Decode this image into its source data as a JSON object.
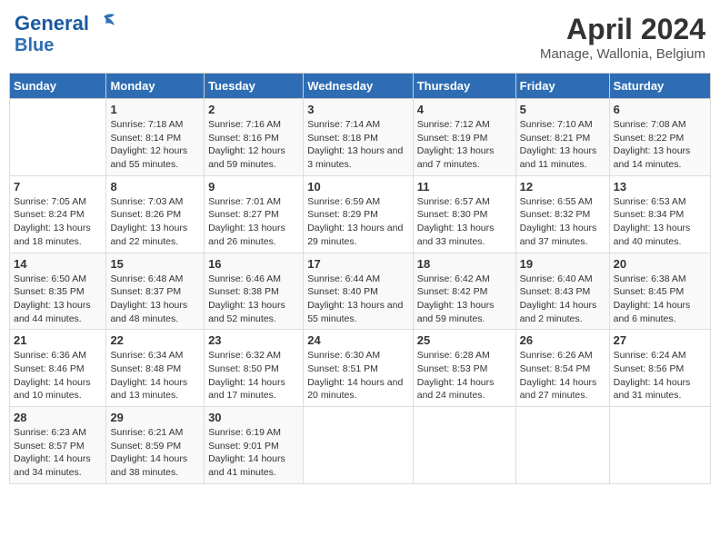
{
  "logo": {
    "line1": "General",
    "line2": "Blue"
  },
  "title": "April 2024",
  "subtitle": "Manage, Wallonia, Belgium",
  "days_of_week": [
    "Sunday",
    "Monday",
    "Tuesday",
    "Wednesday",
    "Thursday",
    "Friday",
    "Saturday"
  ],
  "weeks": [
    [
      {
        "num": "",
        "sunrise": "",
        "sunset": "",
        "daylight": ""
      },
      {
        "num": "1",
        "sunrise": "Sunrise: 7:18 AM",
        "sunset": "Sunset: 8:14 PM",
        "daylight": "Daylight: 12 hours and 55 minutes."
      },
      {
        "num": "2",
        "sunrise": "Sunrise: 7:16 AM",
        "sunset": "Sunset: 8:16 PM",
        "daylight": "Daylight: 12 hours and 59 minutes."
      },
      {
        "num": "3",
        "sunrise": "Sunrise: 7:14 AM",
        "sunset": "Sunset: 8:18 PM",
        "daylight": "Daylight: 13 hours and 3 minutes."
      },
      {
        "num": "4",
        "sunrise": "Sunrise: 7:12 AM",
        "sunset": "Sunset: 8:19 PM",
        "daylight": "Daylight: 13 hours and 7 minutes."
      },
      {
        "num": "5",
        "sunrise": "Sunrise: 7:10 AM",
        "sunset": "Sunset: 8:21 PM",
        "daylight": "Daylight: 13 hours and 11 minutes."
      },
      {
        "num": "6",
        "sunrise": "Sunrise: 7:08 AM",
        "sunset": "Sunset: 8:22 PM",
        "daylight": "Daylight: 13 hours and 14 minutes."
      }
    ],
    [
      {
        "num": "7",
        "sunrise": "Sunrise: 7:05 AM",
        "sunset": "Sunset: 8:24 PM",
        "daylight": "Daylight: 13 hours and 18 minutes."
      },
      {
        "num": "8",
        "sunrise": "Sunrise: 7:03 AM",
        "sunset": "Sunset: 8:26 PM",
        "daylight": "Daylight: 13 hours and 22 minutes."
      },
      {
        "num": "9",
        "sunrise": "Sunrise: 7:01 AM",
        "sunset": "Sunset: 8:27 PM",
        "daylight": "Daylight: 13 hours and 26 minutes."
      },
      {
        "num": "10",
        "sunrise": "Sunrise: 6:59 AM",
        "sunset": "Sunset: 8:29 PM",
        "daylight": "Daylight: 13 hours and 29 minutes."
      },
      {
        "num": "11",
        "sunrise": "Sunrise: 6:57 AM",
        "sunset": "Sunset: 8:30 PM",
        "daylight": "Daylight: 13 hours and 33 minutes."
      },
      {
        "num": "12",
        "sunrise": "Sunrise: 6:55 AM",
        "sunset": "Sunset: 8:32 PM",
        "daylight": "Daylight: 13 hours and 37 minutes."
      },
      {
        "num": "13",
        "sunrise": "Sunrise: 6:53 AM",
        "sunset": "Sunset: 8:34 PM",
        "daylight": "Daylight: 13 hours and 40 minutes."
      }
    ],
    [
      {
        "num": "14",
        "sunrise": "Sunrise: 6:50 AM",
        "sunset": "Sunset: 8:35 PM",
        "daylight": "Daylight: 13 hours and 44 minutes."
      },
      {
        "num": "15",
        "sunrise": "Sunrise: 6:48 AM",
        "sunset": "Sunset: 8:37 PM",
        "daylight": "Daylight: 13 hours and 48 minutes."
      },
      {
        "num": "16",
        "sunrise": "Sunrise: 6:46 AM",
        "sunset": "Sunset: 8:38 PM",
        "daylight": "Daylight: 13 hours and 52 minutes."
      },
      {
        "num": "17",
        "sunrise": "Sunrise: 6:44 AM",
        "sunset": "Sunset: 8:40 PM",
        "daylight": "Daylight: 13 hours and 55 minutes."
      },
      {
        "num": "18",
        "sunrise": "Sunrise: 6:42 AM",
        "sunset": "Sunset: 8:42 PM",
        "daylight": "Daylight: 13 hours and 59 minutes."
      },
      {
        "num": "19",
        "sunrise": "Sunrise: 6:40 AM",
        "sunset": "Sunset: 8:43 PM",
        "daylight": "Daylight: 14 hours and 2 minutes."
      },
      {
        "num": "20",
        "sunrise": "Sunrise: 6:38 AM",
        "sunset": "Sunset: 8:45 PM",
        "daylight": "Daylight: 14 hours and 6 minutes."
      }
    ],
    [
      {
        "num": "21",
        "sunrise": "Sunrise: 6:36 AM",
        "sunset": "Sunset: 8:46 PM",
        "daylight": "Daylight: 14 hours and 10 minutes."
      },
      {
        "num": "22",
        "sunrise": "Sunrise: 6:34 AM",
        "sunset": "Sunset: 8:48 PM",
        "daylight": "Daylight: 14 hours and 13 minutes."
      },
      {
        "num": "23",
        "sunrise": "Sunrise: 6:32 AM",
        "sunset": "Sunset: 8:50 PM",
        "daylight": "Daylight: 14 hours and 17 minutes."
      },
      {
        "num": "24",
        "sunrise": "Sunrise: 6:30 AM",
        "sunset": "Sunset: 8:51 PM",
        "daylight": "Daylight: 14 hours and 20 minutes."
      },
      {
        "num": "25",
        "sunrise": "Sunrise: 6:28 AM",
        "sunset": "Sunset: 8:53 PM",
        "daylight": "Daylight: 14 hours and 24 minutes."
      },
      {
        "num": "26",
        "sunrise": "Sunrise: 6:26 AM",
        "sunset": "Sunset: 8:54 PM",
        "daylight": "Daylight: 14 hours and 27 minutes."
      },
      {
        "num": "27",
        "sunrise": "Sunrise: 6:24 AM",
        "sunset": "Sunset: 8:56 PM",
        "daylight": "Daylight: 14 hours and 31 minutes."
      }
    ],
    [
      {
        "num": "28",
        "sunrise": "Sunrise: 6:23 AM",
        "sunset": "Sunset: 8:57 PM",
        "daylight": "Daylight: 14 hours and 34 minutes."
      },
      {
        "num": "29",
        "sunrise": "Sunrise: 6:21 AM",
        "sunset": "Sunset: 8:59 PM",
        "daylight": "Daylight: 14 hours and 38 minutes."
      },
      {
        "num": "30",
        "sunrise": "Sunrise: 6:19 AM",
        "sunset": "Sunset: 9:01 PM",
        "daylight": "Daylight: 14 hours and 41 minutes."
      },
      {
        "num": "",
        "sunrise": "",
        "sunset": "",
        "daylight": ""
      },
      {
        "num": "",
        "sunrise": "",
        "sunset": "",
        "daylight": ""
      },
      {
        "num": "",
        "sunrise": "",
        "sunset": "",
        "daylight": ""
      },
      {
        "num": "",
        "sunrise": "",
        "sunset": "",
        "daylight": ""
      }
    ]
  ]
}
